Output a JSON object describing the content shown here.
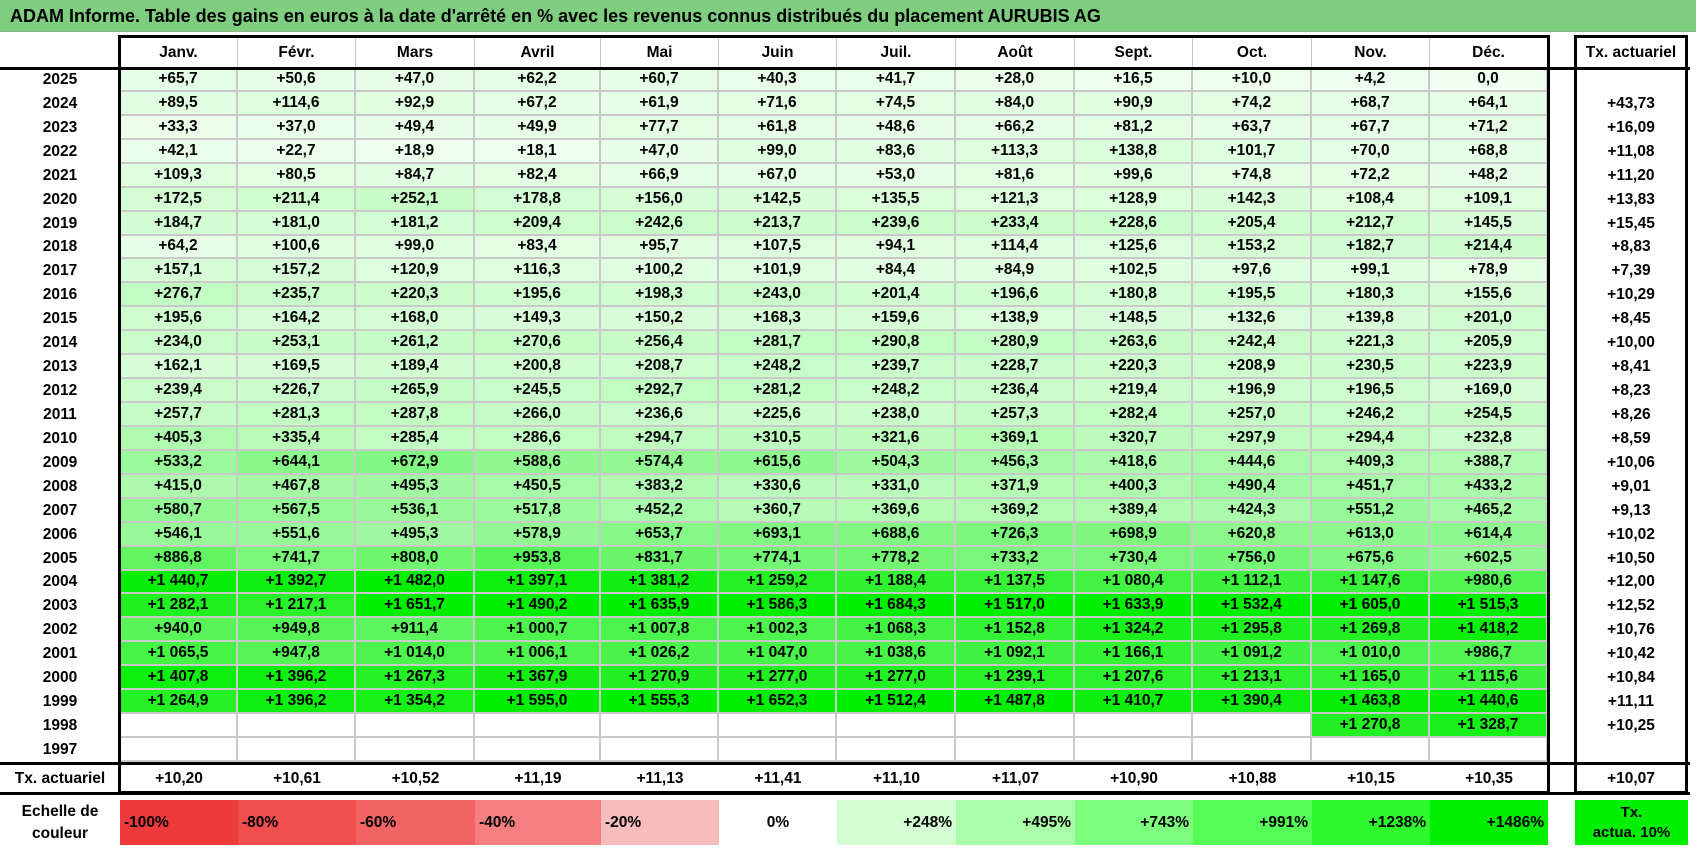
{
  "title": "ADAM Informe. Table des gains en euros à la date d'arrêté en % avec les revenus connus distribués du placement AURUBIS AG",
  "months": [
    "Janv.",
    "Févr.",
    "Mars",
    "Avril",
    "Mai",
    "Juin",
    "Juil.",
    "Août",
    "Sept.",
    "Oct.",
    "Nov.",
    "Déc."
  ],
  "rate_header": "Tx. actuariel",
  "rows": [
    {
      "year": "2025",
      "values": [
        "+65,7",
        "+50,6",
        "+47,0",
        "+62,2",
        "+60,7",
        "+40,3",
        "+41,7",
        "+28,0",
        "+16,5",
        "+10,0",
        "+4,2",
        "0,0"
      ],
      "rate": ""
    },
    {
      "year": "2024",
      "values": [
        "+89,5",
        "+114,6",
        "+92,9",
        "+67,2",
        "+61,9",
        "+71,6",
        "+74,5",
        "+84,0",
        "+90,9",
        "+74,2",
        "+68,7",
        "+64,1"
      ],
      "rate": "+43,73"
    },
    {
      "year": "2023",
      "values": [
        "+33,3",
        "+37,0",
        "+49,4",
        "+49,9",
        "+77,7",
        "+61,8",
        "+48,6",
        "+66,2",
        "+81,2",
        "+63,7",
        "+67,7",
        "+71,2"
      ],
      "rate": "+16,09"
    },
    {
      "year": "2022",
      "values": [
        "+42,1",
        "+22,7",
        "+18,9",
        "+18,1",
        "+47,0",
        "+99,0",
        "+83,6",
        "+113,3",
        "+138,8",
        "+101,7",
        "+70,0",
        "+68,8"
      ],
      "rate": "+11,08"
    },
    {
      "year": "2021",
      "values": [
        "+109,3",
        "+80,5",
        "+84,7",
        "+82,4",
        "+66,9",
        "+67,0",
        "+53,0",
        "+81,6",
        "+99,6",
        "+74,8",
        "+72,2",
        "+48,2"
      ],
      "rate": "+11,20"
    },
    {
      "year": "2020",
      "values": [
        "+172,5",
        "+211,4",
        "+252,1",
        "+178,8",
        "+156,0",
        "+142,5",
        "+135,5",
        "+121,3",
        "+128,9",
        "+142,3",
        "+108,4",
        "+109,1"
      ],
      "rate": "+13,83"
    },
    {
      "year": "2019",
      "values": [
        "+184,7",
        "+181,0",
        "+181,2",
        "+209,4",
        "+242,6",
        "+213,7",
        "+239,6",
        "+233,4",
        "+228,6",
        "+205,4",
        "+212,7",
        "+145,5"
      ],
      "rate": "+15,45"
    },
    {
      "year": "2018",
      "values": [
        "+64,2",
        "+100,6",
        "+99,0",
        "+83,4",
        "+95,7",
        "+107,5",
        "+94,1",
        "+114,4",
        "+125,6",
        "+153,2",
        "+182,7",
        "+214,4"
      ],
      "rate": "+8,83"
    },
    {
      "year": "2017",
      "values": [
        "+157,1",
        "+157,2",
        "+120,9",
        "+116,3",
        "+100,2",
        "+101,9",
        "+84,4",
        "+84,9",
        "+102,5",
        "+97,6",
        "+99,1",
        "+78,9"
      ],
      "rate": "+7,39"
    },
    {
      "year": "2016",
      "values": [
        "+276,7",
        "+235,7",
        "+220,3",
        "+195,6",
        "+198,3",
        "+243,0",
        "+201,4",
        "+196,6",
        "+180,8",
        "+195,5",
        "+180,3",
        "+155,6"
      ],
      "rate": "+10,29"
    },
    {
      "year": "2015",
      "values": [
        "+195,6",
        "+164,2",
        "+168,0",
        "+149,3",
        "+150,2",
        "+168,3",
        "+159,6",
        "+138,9",
        "+148,5",
        "+132,6",
        "+139,8",
        "+201,0"
      ],
      "rate": "+8,45"
    },
    {
      "year": "2014",
      "values": [
        "+234,0",
        "+253,1",
        "+261,2",
        "+270,6",
        "+256,4",
        "+281,7",
        "+290,8",
        "+280,9",
        "+263,6",
        "+242,4",
        "+221,3",
        "+205,9"
      ],
      "rate": "+10,00"
    },
    {
      "year": "2013",
      "values": [
        "+162,1",
        "+169,5",
        "+189,4",
        "+200,8",
        "+208,7",
        "+248,2",
        "+239,7",
        "+228,7",
        "+220,3",
        "+208,9",
        "+230,5",
        "+223,9"
      ],
      "rate": "+8,41"
    },
    {
      "year": "2012",
      "values": [
        "+239,4",
        "+226,7",
        "+265,9",
        "+245,5",
        "+292,7",
        "+281,2",
        "+248,2",
        "+236,4",
        "+219,4",
        "+196,9",
        "+196,5",
        "+169,0"
      ],
      "rate": "+8,23"
    },
    {
      "year": "2011",
      "values": [
        "+257,7",
        "+281,3",
        "+287,8",
        "+266,0",
        "+236,6",
        "+225,6",
        "+238,0",
        "+257,3",
        "+282,4",
        "+257,0",
        "+246,2",
        "+254,5"
      ],
      "rate": "+8,26"
    },
    {
      "year": "2010",
      "values": [
        "+405,3",
        "+335,4",
        "+285,4",
        "+286,6",
        "+294,7",
        "+310,5",
        "+321,6",
        "+369,1",
        "+320,7",
        "+297,9",
        "+294,4",
        "+232,8"
      ],
      "rate": "+8,59"
    },
    {
      "year": "2009",
      "values": [
        "+533,2",
        "+644,1",
        "+672,9",
        "+588,6",
        "+574,4",
        "+615,6",
        "+504,3",
        "+456,3",
        "+418,6",
        "+444,6",
        "+409,3",
        "+388,7"
      ],
      "rate": "+10,06"
    },
    {
      "year": "2008",
      "values": [
        "+415,0",
        "+467,8",
        "+495,3",
        "+450,5",
        "+383,2",
        "+330,6",
        "+331,0",
        "+371,9",
        "+400,3",
        "+490,4",
        "+451,7",
        "+433,2"
      ],
      "rate": "+9,01"
    },
    {
      "year": "2007",
      "values": [
        "+580,7",
        "+567,5",
        "+536,1",
        "+517,8",
        "+452,2",
        "+360,7",
        "+369,6",
        "+369,2",
        "+389,4",
        "+424,3",
        "+551,2",
        "+465,2"
      ],
      "rate": "+9,13"
    },
    {
      "year": "2006",
      "values": [
        "+546,1",
        "+551,6",
        "+495,3",
        "+578,9",
        "+653,7",
        "+693,1",
        "+688,6",
        "+726,3",
        "+698,9",
        "+620,8",
        "+613,0",
        "+614,4"
      ],
      "rate": "+10,02"
    },
    {
      "year": "2005",
      "values": [
        "+886,8",
        "+741,7",
        "+808,0",
        "+953,8",
        "+831,7",
        "+774,1",
        "+778,2",
        "+733,2",
        "+730,4",
        "+756,0",
        "+675,6",
        "+602,5"
      ],
      "rate": "+10,50"
    },
    {
      "year": "2004",
      "values": [
        "+1 440,7",
        "+1 392,7",
        "+1 482,0",
        "+1 397,1",
        "+1 381,2",
        "+1 259,2",
        "+1 188,4",
        "+1 137,5",
        "+1 080,4",
        "+1 112,1",
        "+1 147,6",
        "+980,6"
      ],
      "rate": "+12,00"
    },
    {
      "year": "2003",
      "values": [
        "+1 282,1",
        "+1 217,1",
        "+1 651,7",
        "+1 490,2",
        "+1 635,9",
        "+1 586,3",
        "+1 684,3",
        "+1 517,0",
        "+1 633,9",
        "+1 532,4",
        "+1 605,0",
        "+1 515,3"
      ],
      "rate": "+12,52"
    },
    {
      "year": "2002",
      "values": [
        "+940,0",
        "+949,8",
        "+911,4",
        "+1 000,7",
        "+1 007,8",
        "+1 002,3",
        "+1 068,3",
        "+1 152,8",
        "+1 324,2",
        "+1 295,8",
        "+1 269,8",
        "+1 418,2"
      ],
      "rate": "+10,76"
    },
    {
      "year": "2001",
      "values": [
        "+1 065,5",
        "+947,8",
        "+1 014,0",
        "+1 006,1",
        "+1 026,2",
        "+1 047,0",
        "+1 038,6",
        "+1 092,1",
        "+1 166,1",
        "+1 091,2",
        "+1 010,0",
        "+986,7"
      ],
      "rate": "+10,42"
    },
    {
      "year": "2000",
      "values": [
        "+1 407,8",
        "+1 396,2",
        "+1 267,3",
        "+1 367,9",
        "+1 270,9",
        "+1 277,0",
        "+1 277,0",
        "+1 239,1",
        "+1 207,6",
        "+1 213,1",
        "+1 165,0",
        "+1 115,6"
      ],
      "rate": "+10,84"
    },
    {
      "year": "1999",
      "values": [
        "+1 264,9",
        "+1 396,2",
        "+1 354,2",
        "+1 595,0",
        "+1 555,3",
        "+1 652,3",
        "+1 512,4",
        "+1 487,8",
        "+1 410,7",
        "+1 390,4",
        "+1 463,8",
        "+1 440,6"
      ],
      "rate": "+11,11"
    },
    {
      "year": "1998",
      "values": [
        "",
        "",
        "",
        "",
        "",
        "",
        "",
        "",
        "",
        "",
        "+1 270,8",
        "+1 328,7"
      ],
      "rate": "+10,25"
    },
    {
      "year": "1997",
      "values": [
        "",
        "",
        "",
        "",
        "",
        "",
        "",
        "",
        "",
        "",
        "",
        ""
      ],
      "rate": ""
    }
  ],
  "footer": {
    "label": "Tx. actuariel",
    "values": [
      "+10,20",
      "+10,61",
      "+10,52",
      "+11,19",
      "+11,13",
      "+11,41",
      "+11,10",
      "+11,07",
      "+10,90",
      "+10,88",
      "+10,15",
      "+10,35"
    ],
    "rate": "+10,07"
  },
  "legend": {
    "label_line1": "Echelle de",
    "label_line2": "couleur",
    "items": [
      {
        "text": "-100%",
        "color": "#ee3a3a"
      },
      {
        "text": "-80%",
        "color": "#f04d4d"
      },
      {
        "text": "-60%",
        "color": "#f26363"
      },
      {
        "text": "-40%",
        "color": "#f57e7e"
      },
      {
        "text": "-20%",
        "color": "#f9bcbc"
      },
      {
        "text": "0%",
        "color": "#ffffff"
      },
      {
        "text": "+248%",
        "color": "#d3ffd3"
      },
      {
        "text": "+495%",
        "color": "#a8ffa8"
      },
      {
        "text": "+743%",
        "color": "#7dff7d"
      },
      {
        "text": "+991%",
        "color": "#55fc55"
      },
      {
        "text": "+1238%",
        "color": "#2ef72e"
      },
      {
        "text": "+1486%",
        "color": "#00ee00"
      }
    ],
    "actuarial_line1": "Tx.",
    "actuarial_line2": "actua. 10%",
    "actuarial_color": "#00ee00"
  }
}
